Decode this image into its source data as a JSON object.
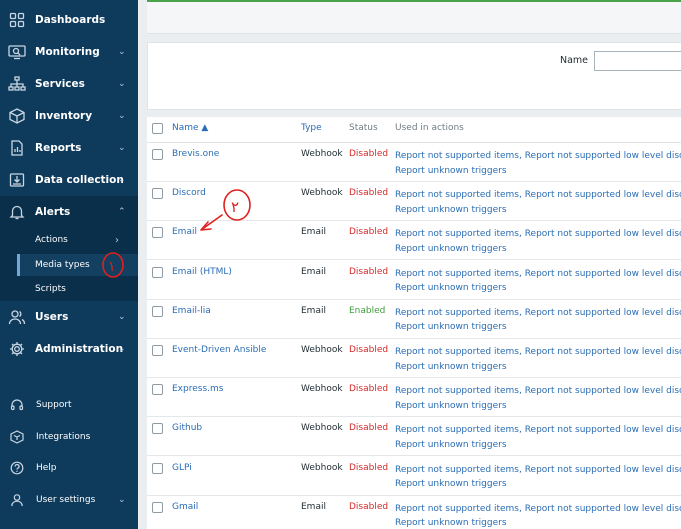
{
  "sidebar": {
    "items": [
      {
        "label": "Dashboards",
        "icon": "dashboards-icon",
        "chevron": ""
      },
      {
        "label": "Monitoring",
        "icon": "monitoring-icon",
        "chevron": "⌄"
      },
      {
        "label": "Services",
        "icon": "services-icon",
        "chevron": "⌄"
      },
      {
        "label": "Inventory",
        "icon": "inventory-icon",
        "chevron": "⌄"
      },
      {
        "label": "Reports",
        "icon": "reports-icon",
        "chevron": "⌄"
      },
      {
        "label": "Data collection",
        "icon": "data-collection-icon",
        "chevron": "⌄"
      },
      {
        "label": "Alerts",
        "icon": "bell-icon",
        "chevron": "⌃"
      },
      {
        "label": "Users",
        "icon": "users-icon",
        "chevron": "⌄"
      },
      {
        "label": "Administration",
        "icon": "gear-icon",
        "chevron": "⌄"
      }
    ],
    "alerts_submenu": [
      {
        "label": "Actions",
        "chevron": "›"
      },
      {
        "label": "Media types",
        "chevron": ""
      },
      {
        "label": "Scripts",
        "chevron": ""
      }
    ],
    "bottom": [
      {
        "label": "Support",
        "icon": "headset-icon"
      },
      {
        "label": "Integrations",
        "icon": "integrations-icon"
      },
      {
        "label": "Help",
        "icon": "help-icon"
      },
      {
        "label": "User settings",
        "icon": "user-icon",
        "chevron": "⌄"
      }
    ]
  },
  "filter": {
    "name_label": "Name",
    "name_value": ""
  },
  "table": {
    "headers": {
      "name": "Name ▲",
      "type": "Type",
      "status": "Status",
      "used": "Used in actions"
    },
    "used_line1": "Report not supported items, Report not supported low level discove",
    "used_line2": "Report unknown triggers",
    "rows": [
      {
        "name": "Brevis.one",
        "type": "Webhook",
        "status": "Disabled"
      },
      {
        "name": "Discord",
        "type": "Webhook",
        "status": "Disabled"
      },
      {
        "name": "Email",
        "type": "Email",
        "status": "Disabled"
      },
      {
        "name": "Email (HTML)",
        "type": "Email",
        "status": "Disabled"
      },
      {
        "name": "Email-lia",
        "type": "Email",
        "status": "Enabled"
      },
      {
        "name": "Event-Driven Ansible",
        "type": "Webhook",
        "status": "Disabled"
      },
      {
        "name": "Express.ms",
        "type": "Webhook",
        "status": "Disabled"
      },
      {
        "name": "Github",
        "type": "Webhook",
        "status": "Disabled"
      },
      {
        "name": "GLPi",
        "type": "Webhook",
        "status": "Disabled"
      },
      {
        "name": "Gmail",
        "type": "Email",
        "status": "Disabled"
      }
    ]
  },
  "annotations": {
    "mark1": "١",
    "mark2": "٢"
  },
  "colors": {
    "sidebar": "#0e3a5c",
    "link": "#2a6db5",
    "disabled": "#d42a2a",
    "enabled": "#3f9e3f",
    "annotation": "#e0201c"
  }
}
